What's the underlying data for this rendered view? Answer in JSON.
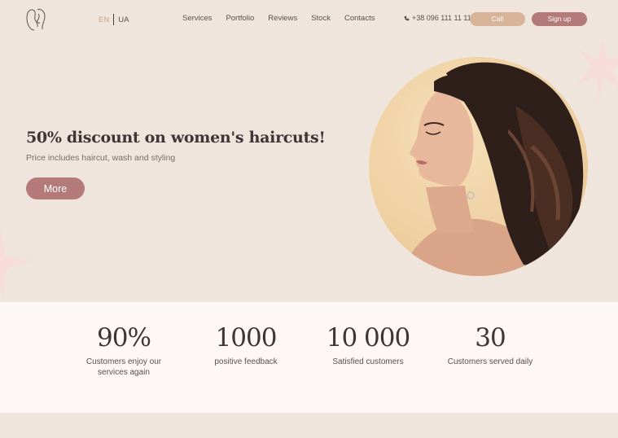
{
  "header": {
    "lang_en": "EN",
    "lang_ua": "UA",
    "nav": [
      "Services",
      "Portfolio",
      "Reviews",
      "Stock",
      "Contacts"
    ],
    "phone": "+38 096 111 11 11",
    "call_label": "Call",
    "signup_label": "Sign up"
  },
  "hero": {
    "title": "50% discount on women's haircuts!",
    "subtitle": "Price includes haircut, wash and styling",
    "more_label": "More"
  },
  "stats": [
    {
      "value": "90%",
      "label": "Customers enjoy our services again"
    },
    {
      "value": "1000",
      "label": "positive feedback"
    },
    {
      "value": "10 000",
      "label": "Satisfied customers"
    },
    {
      "value": "30",
      "label": "Customers served daily"
    }
  ],
  "colors": {
    "background": "#efe5dc",
    "accent_rose": "#b37a78",
    "accent_sand": "#d8b499",
    "stats_bg": "#fdf7f5"
  },
  "icons": {
    "logo": "face-profile-logo-icon",
    "phone": "phone-icon",
    "sparkle": "sparkle-star-icon"
  }
}
